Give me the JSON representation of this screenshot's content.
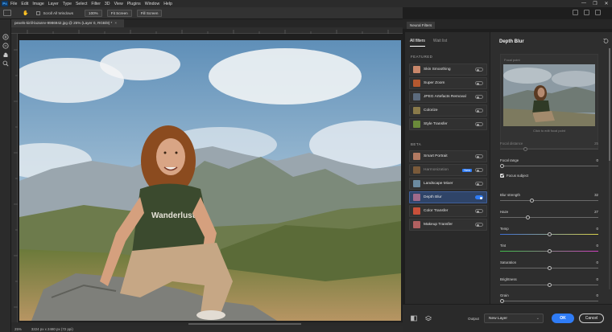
{
  "app": {
    "logo": "Ps",
    "menu": [
      "File",
      "Edit",
      "Image",
      "Layer",
      "Type",
      "Select",
      "Filter",
      "3D",
      "View",
      "Plugins",
      "Window",
      "Help"
    ],
    "window_controls": [
      "—",
      "❐",
      "✕"
    ]
  },
  "options_bar": {
    "scroll_all_windows": "Scroll All Windows",
    "zoom_100": "100%",
    "fit_screen": "Fit Screen",
    "fill_screen": "Fill Screen"
  },
  "document": {
    "tab_title": "pexels-kirill-lazarev-9986942.jpg @ 25% (Layer 0, RGB/8) *",
    "tab_close": "×",
    "status_zoom": "25%",
    "status_info": "3224 px x 2480 px (72 ppi)"
  },
  "neural_filters": {
    "panel_title": "Neural Filters",
    "tabs": [
      {
        "label": "All filters",
        "active": true
      },
      {
        "label": "Wait list",
        "active": false
      }
    ],
    "featured_heading": "FEATURED",
    "beta_heading": "BETA",
    "featured": [
      {
        "label": "Skin Smoothing",
        "on": false,
        "thumb": "#c9876a"
      },
      {
        "label": "Super Zoom",
        "on": false,
        "thumb": "#b5582f"
      },
      {
        "label": "JPEG Artefacts Removal",
        "on": false,
        "thumb": "#5c6b7e"
      },
      {
        "label": "Colorize",
        "on": false,
        "thumb": "#8a7a4a"
      },
      {
        "label": "Style Transfer",
        "on": false,
        "thumb": "#6a8a3a"
      }
    ],
    "beta": [
      {
        "label": "Smart Portrait",
        "on": false,
        "thumb": "#b27a62",
        "disabled": false,
        "badge": ""
      },
      {
        "label": "Harmonization",
        "on": false,
        "thumb": "#7a5a3a",
        "disabled": true,
        "badge": "New"
      },
      {
        "label": "Landscape Mixer",
        "on": false,
        "thumb": "#6b8aa0",
        "disabled": false,
        "badge": ""
      },
      {
        "label": "Depth Blur",
        "on": true,
        "thumb": "#a06a8a",
        "disabled": false,
        "badge": ""
      },
      {
        "label": "Color Transfer",
        "on": false,
        "thumb": "#c8503a",
        "disabled": false,
        "badge": ""
      },
      {
        "label": "Makeup Transfer",
        "on": false,
        "thumb": "#b06060",
        "disabled": false,
        "badge": ""
      }
    ]
  },
  "depth_blur": {
    "title": "Depth Blur",
    "focal_point_label": "Focal point",
    "focal_hint": "Click to edit focal point",
    "focal_distance": {
      "label": "Focal distance",
      "value": "25",
      "level": 0.25
    },
    "focal_range": {
      "label": "Focal range",
      "value": "0",
      "level": 0.0
    },
    "focus_subject": "Focus subject",
    "blur_strength": {
      "label": "Blur strength",
      "value": "32",
      "level": 0.32
    },
    "haze": {
      "label": "Haze",
      "value": "27",
      "level": 0.27
    },
    "temp": {
      "label": "Temp",
      "value": "0",
      "level": 0.5
    },
    "tint": {
      "label": "Tint",
      "value": "0",
      "level": 0.5
    },
    "saturation": {
      "label": "Saturation",
      "value": "0",
      "level": 0.5
    },
    "brightness": {
      "label": "Brightness",
      "value": "0",
      "level": 0.5
    },
    "grain": {
      "label": "Grain",
      "value": "0",
      "level": 0.0
    }
  },
  "bottom_bar": {
    "output_label": "Output",
    "output_value": "New Layer",
    "ok": "OK",
    "cancel": "Cancel"
  },
  "colors": {
    "accent": "#2f7cf6",
    "selected_item": "#2f4468"
  }
}
